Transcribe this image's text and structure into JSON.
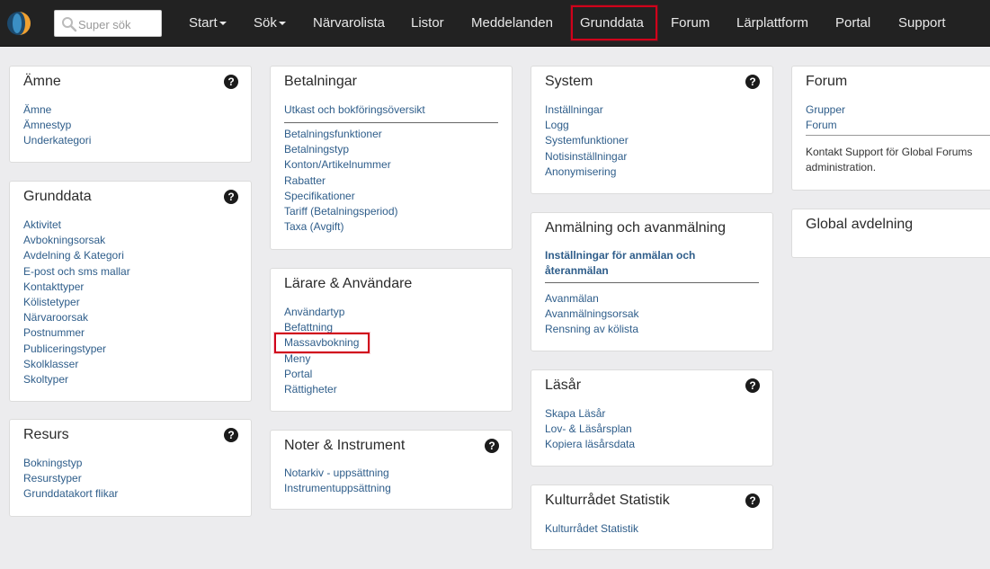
{
  "search": {
    "placeholder": "Super sök"
  },
  "nav": {
    "start": "Start",
    "sok": "Sök",
    "narvarolista": "Närvarolista",
    "listor": "Listor",
    "meddelanden": "Meddelanden",
    "grunddata": "Grunddata",
    "forum": "Forum",
    "larplattform": "Lärplattform",
    "portal": "Portal",
    "support": "Support"
  },
  "colors": {
    "navbar": "#222222",
    "link": "#2e5d8a",
    "highlight": "#d0021b"
  },
  "panels": {
    "amne": {
      "title": "Ämne",
      "links": [
        "Ämne",
        "Ämnestyp",
        "Underkategori"
      ]
    },
    "grunddata": {
      "title": "Grunddata",
      "links": [
        "Aktivitet",
        "Avbokningsorsak",
        "Avdelning & Kategori",
        "E-post och sms mallar",
        "Kontakttyper",
        "Kölistetyper",
        "Närvaroorsak",
        "Postnummer",
        "Publiceringstyper",
        "Skolklasser",
        "Skoltyper"
      ]
    },
    "resurs": {
      "title": "Resurs",
      "links": [
        "Bokningstyp",
        "Resurstyper",
        "Grunddatakort flikar"
      ]
    },
    "betalningar": {
      "title": "Betalningar",
      "top_link": "Utkast och bokföringsöversikt",
      "links": [
        "Betalningsfunktioner",
        "Betalningstyp",
        "Konton/Artikelnummer",
        "Rabatter",
        "Specifikationer",
        "Tariff (Betalningsperiod)",
        "Taxa (Avgift)"
      ]
    },
    "larare": {
      "title": "Lärare & Användare",
      "links": [
        "Användartyp",
        "Befattning",
        "Massavbokning",
        "Meny",
        "Portal",
        "Rättigheter"
      ]
    },
    "noter": {
      "title": "Noter & Instrument",
      "links": [
        "Notarkiv - uppsättning",
        "Instrumentuppsättning"
      ]
    },
    "system": {
      "title": "System",
      "links": [
        "Inställningar",
        "Logg",
        "Systemfunktioner",
        "Notisinställningar",
        "Anonymisering"
      ]
    },
    "anmalning": {
      "title": "Anmälning och avanmälning",
      "head_link": "Inställningar för anmälan och återanmälan",
      "links": [
        "Avanmälan",
        "Avanmälningsorsak",
        "Rensning av kölista"
      ]
    },
    "lasar": {
      "title": "Läsår",
      "links": [
        "Skapa Läsår",
        "Lov- & Läsårsplan",
        "Kopiera läsårsdata"
      ]
    },
    "kulturradet": {
      "title": "Kulturrådet Statistik",
      "links": [
        "Kulturrådet Statistik"
      ]
    },
    "forum": {
      "title": "Forum",
      "links": [
        "Grupper",
        "Forum"
      ],
      "note": "Kontakt Support för Global Forums administration."
    },
    "global": {
      "title": "Global avdelning"
    }
  }
}
